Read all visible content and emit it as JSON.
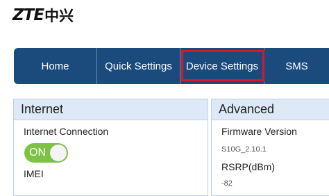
{
  "logo": {
    "brand": "ZTE",
    "chinese": "中兴"
  },
  "nav": {
    "items": [
      {
        "label": "Home"
      },
      {
        "label": "Quick Settings"
      },
      {
        "label": "Device Settings"
      },
      {
        "label": "SMS"
      }
    ],
    "highlighted_item": "Device Settings",
    "highlight_color": "#d8172a",
    "background_color": "#1b4a7d"
  },
  "internet": {
    "title": "Internet",
    "connection_label": "Internet Connection",
    "toggle_text": "ON",
    "toggle_color": "#7dc243",
    "imei_label": "IMEI"
  },
  "advanced": {
    "title": "Advanced",
    "firmware_label": "Firmware Version",
    "firmware_value": "S10G_2.10.1",
    "rsrp_label": "RSRP(dBm)",
    "rsrp_value": "-82"
  }
}
